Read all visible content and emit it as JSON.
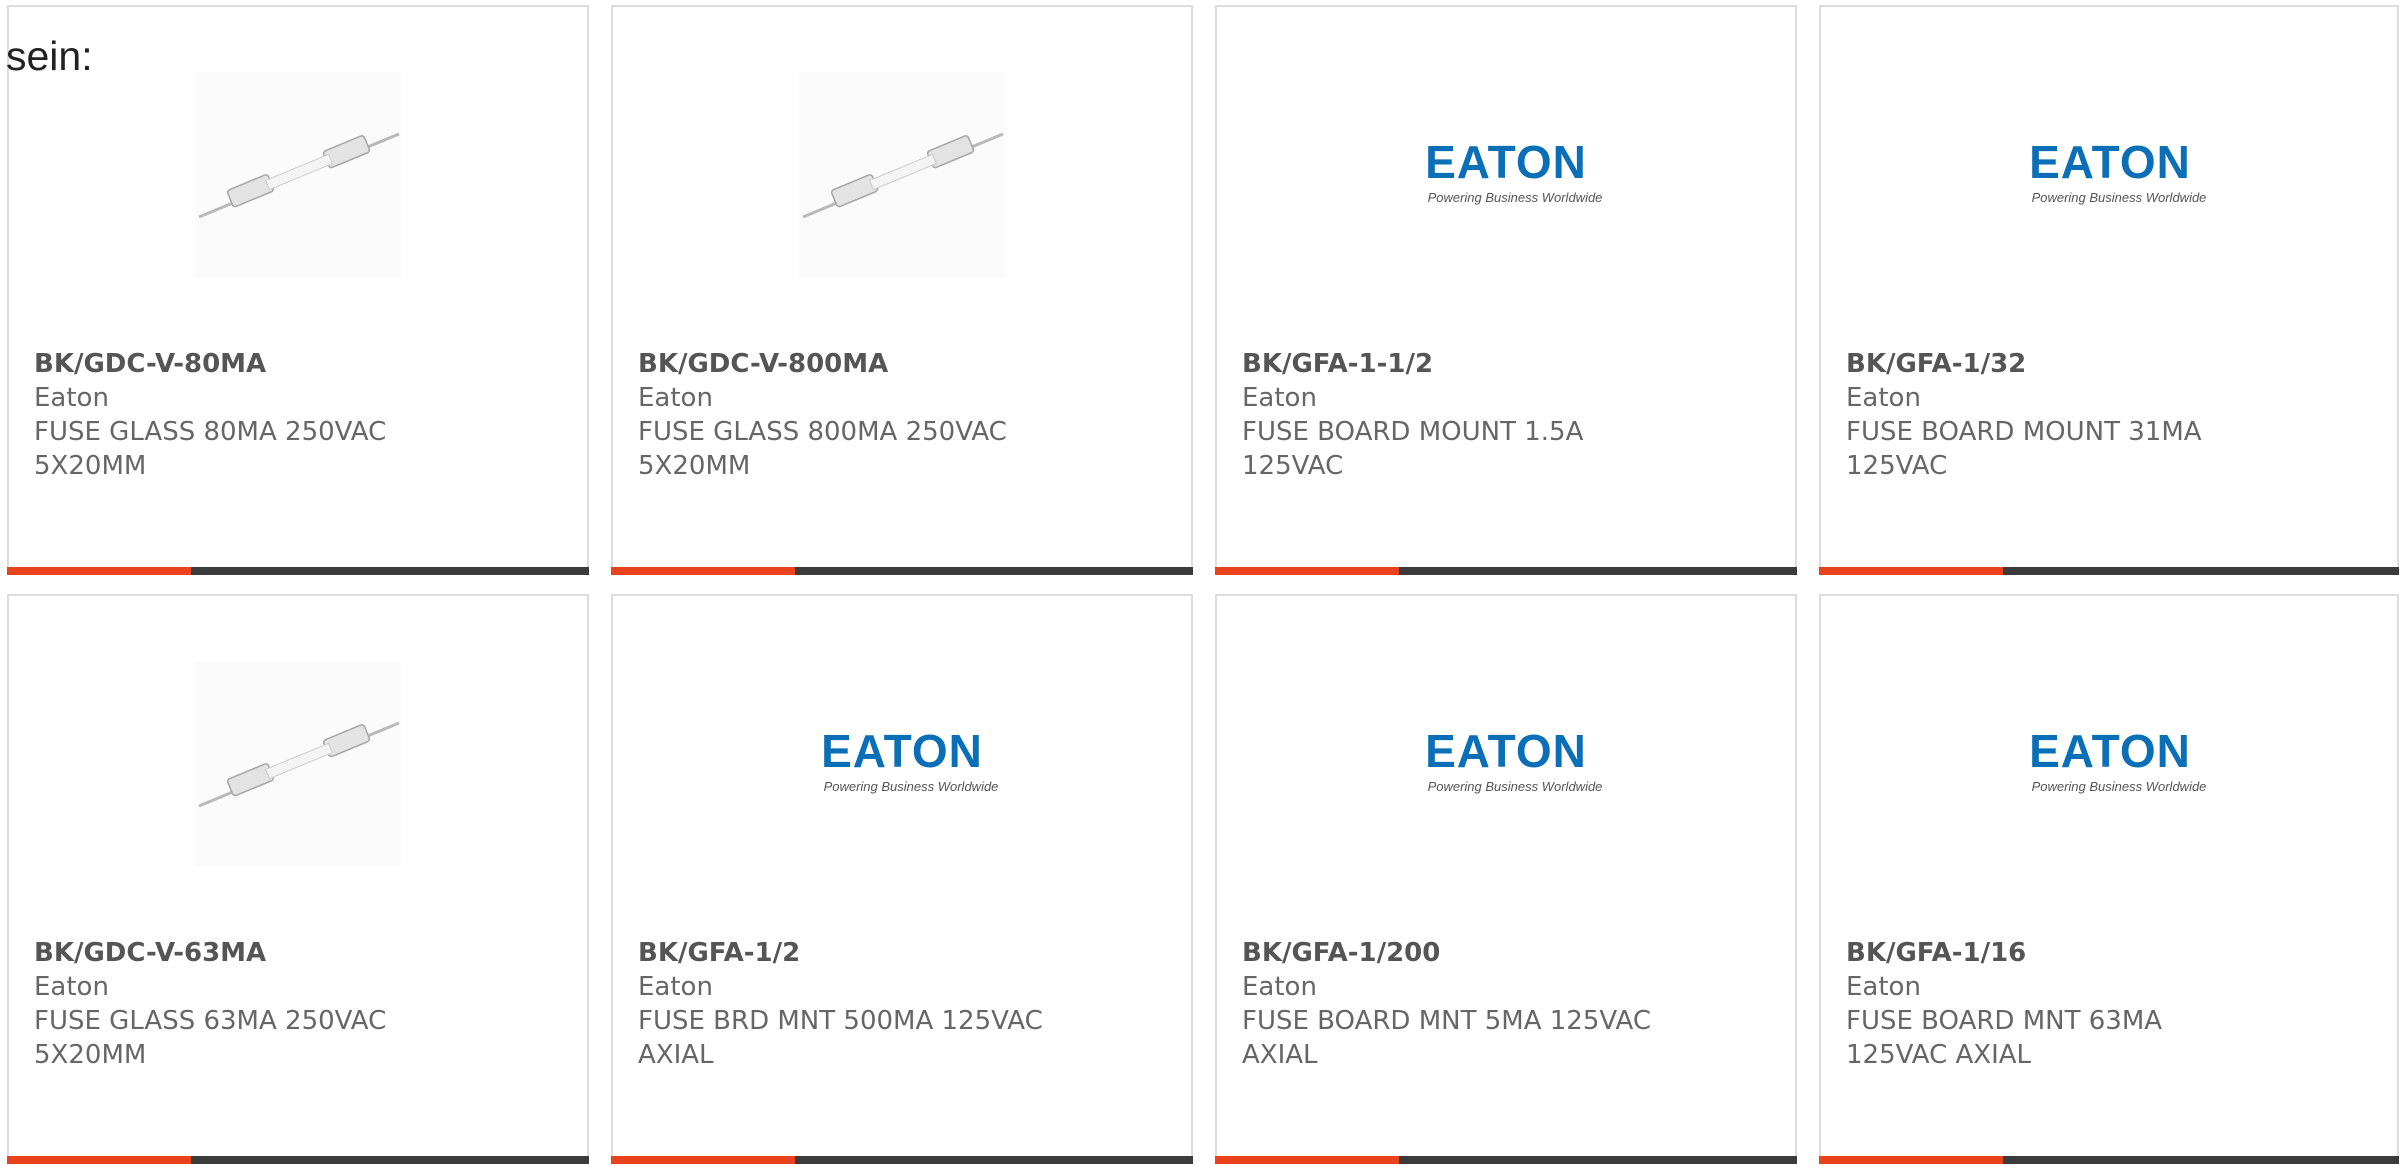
{
  "intro_text": "sein:",
  "colors": {
    "accent": "#e8431c",
    "bar_dark": "#3b3b3b",
    "eaton_blue": "#0b6fb7",
    "text": "#666666"
  },
  "cards": [
    {
      "part_number": "BK/GDC-V-80MA",
      "manufacturer": "Eaton",
      "description": "FUSE GLASS 80MA 250VAC 5X20MM",
      "image": "fuse-photo-icon"
    },
    {
      "part_number": "BK/GDC-V-800MA",
      "manufacturer": "Eaton",
      "description": "FUSE GLASS 800MA 250VAC 5X20MM",
      "image": "fuse-photo-icon"
    },
    {
      "part_number": "BK/GFA-1-1/2",
      "manufacturer": "Eaton",
      "description": "FUSE BOARD MOUNT 1.5A 125VAC",
      "image": "eaton-logo"
    },
    {
      "part_number": "BK/GFA-1/32",
      "manufacturer": "Eaton",
      "description": "FUSE BOARD MOUNT 31MA 125VAC",
      "image": "eaton-logo"
    },
    {
      "part_number": "BK/GDC-V-63MA",
      "manufacturer": "Eaton",
      "description": "FUSE GLASS 63MA 250VAC 5X20MM",
      "image": "fuse-photo-icon"
    },
    {
      "part_number": "BK/GFA-1/2",
      "manufacturer": "Eaton",
      "description": "FUSE BRD MNT 500MA 125VAC AXIAL",
      "image": "eaton-logo"
    },
    {
      "part_number": "BK/GFA-1/200",
      "manufacturer": "Eaton",
      "description": "FUSE BOARD MNT 5MA 125VAC AXIAL",
      "image": "eaton-logo"
    },
    {
      "part_number": "BK/GFA-1/16",
      "manufacturer": "Eaton",
      "description": "FUSE BOARD MNT 63MA 125VAC AXIAL",
      "image": "eaton-logo"
    }
  ],
  "logo": {
    "word": "EATON",
    "tagline": "Powering Business Worldwide"
  }
}
